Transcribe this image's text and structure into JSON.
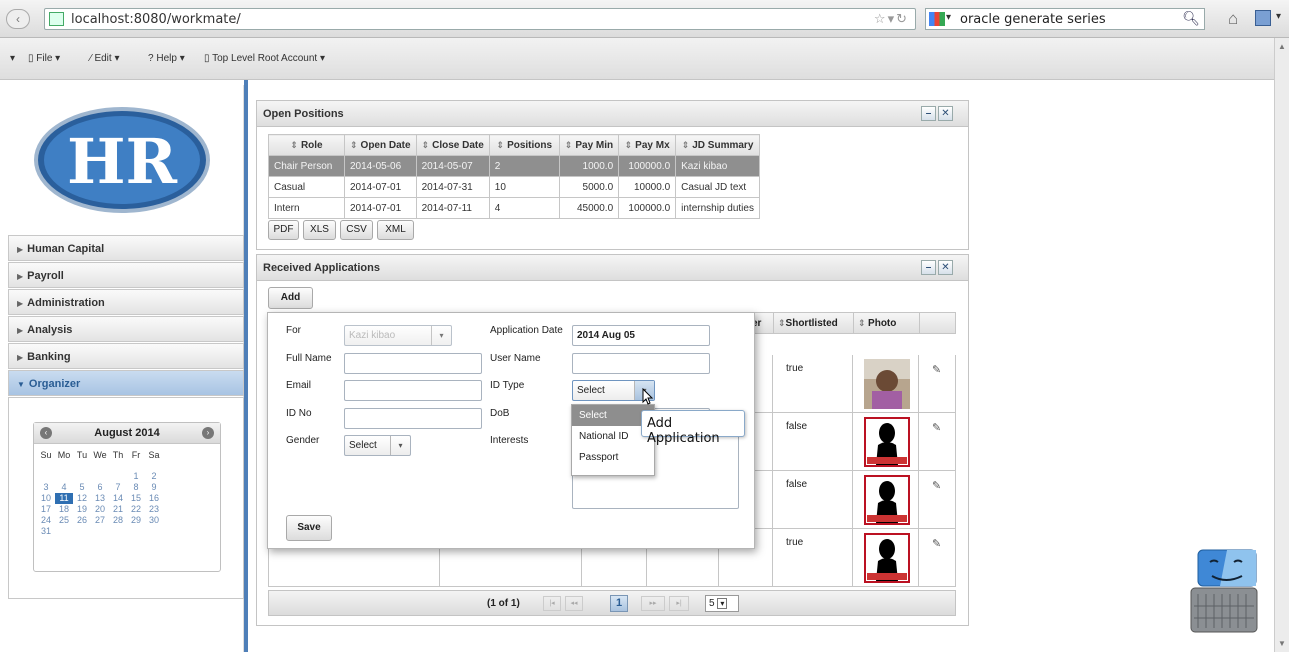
{
  "browser": {
    "url": "localhost:8080/workmate/",
    "search_query": "oracle generate series"
  },
  "menu": {
    "file": "File",
    "edit": "Edit",
    "help": "Help",
    "account": "Top Level Root Account"
  },
  "sidebar": {
    "logo_text": "HR",
    "items": [
      {
        "label": "Human Capital"
      },
      {
        "label": "Payroll"
      },
      {
        "label": "Administration"
      },
      {
        "label": "Analysis"
      },
      {
        "label": "Banking"
      },
      {
        "label": "Organizer"
      }
    ]
  },
  "calendar": {
    "title": "August 2014",
    "prev": "‹",
    "next": "›",
    "weekdays": [
      "Su",
      "Mo",
      "Tu",
      "We",
      "Th",
      "Fr",
      "Sa"
    ],
    "weeks": [
      [
        "",
        "",
        "",
        "",
        "",
        "1",
        "2"
      ],
      [
        "3",
        "4",
        "5",
        "6",
        "7",
        "8",
        "9"
      ],
      [
        "10",
        "11",
        "12",
        "13",
        "14",
        "15",
        "16"
      ],
      [
        "17",
        "18",
        "19",
        "20",
        "21",
        "22",
        "23"
      ],
      [
        "24",
        "25",
        "26",
        "27",
        "28",
        "29",
        "30"
      ],
      [
        "31",
        "",
        "",
        "",
        "",
        "",
        ""
      ]
    ],
    "selected_day": "11"
  },
  "open_positions": {
    "title": "Open Positions",
    "columns": [
      "Role",
      "Open Date",
      "Close Date",
      "Positions",
      "Pay Min",
      "Pay Mx",
      "JD Summary"
    ],
    "rows": [
      [
        "Chair Person",
        "2014-05-06",
        "2014-05-07",
        "2",
        "1000.0",
        "100000.0",
        "Kazi kibao"
      ],
      [
        "Casual",
        "2014-07-01",
        "2014-07-31",
        "10",
        "5000.0",
        "10000.0",
        "Casual JD text"
      ],
      [
        "Intern",
        "2014-07-01",
        "2014-07-11",
        "4",
        "45000.0",
        "100000.0",
        "internship duties"
      ]
    ],
    "export": {
      "pdf": "PDF",
      "xls": "XLS",
      "csv": "CSV",
      "xml": "XML"
    }
  },
  "received_applications": {
    "title": "Received Applications",
    "add_label": "Add",
    "col_partial": "er",
    "col_shortlisted": "Shortlisted",
    "col_photo": "Photo",
    "shortlisted_values": [
      "true",
      "false",
      "false",
      "true"
    ],
    "paginator": {
      "report": "(1 of 1)",
      "first": "|◂",
      "prev": "◂◂",
      "page": "1",
      "next": "▸▸",
      "last": "▸|",
      "rows": "5"
    }
  },
  "dialog": {
    "for_label": "For",
    "for_value": "Kazi kibao",
    "fullname_label": "Full Name",
    "email_label": "Email",
    "idno_label": "ID No",
    "gender_label": "Gender",
    "gender_value": "Select",
    "appdate_label": "Application Date",
    "appdate_value": "2014 Aug 05",
    "username_label": "User Name",
    "idtype_label": "ID Type",
    "idtype_value": "Select",
    "dob_label": "DoB",
    "interests_label": "Interests",
    "save_label": "Save",
    "idtype_options": [
      "Select",
      "National ID",
      "Passport"
    ]
  },
  "tooltip": "Add Application"
}
